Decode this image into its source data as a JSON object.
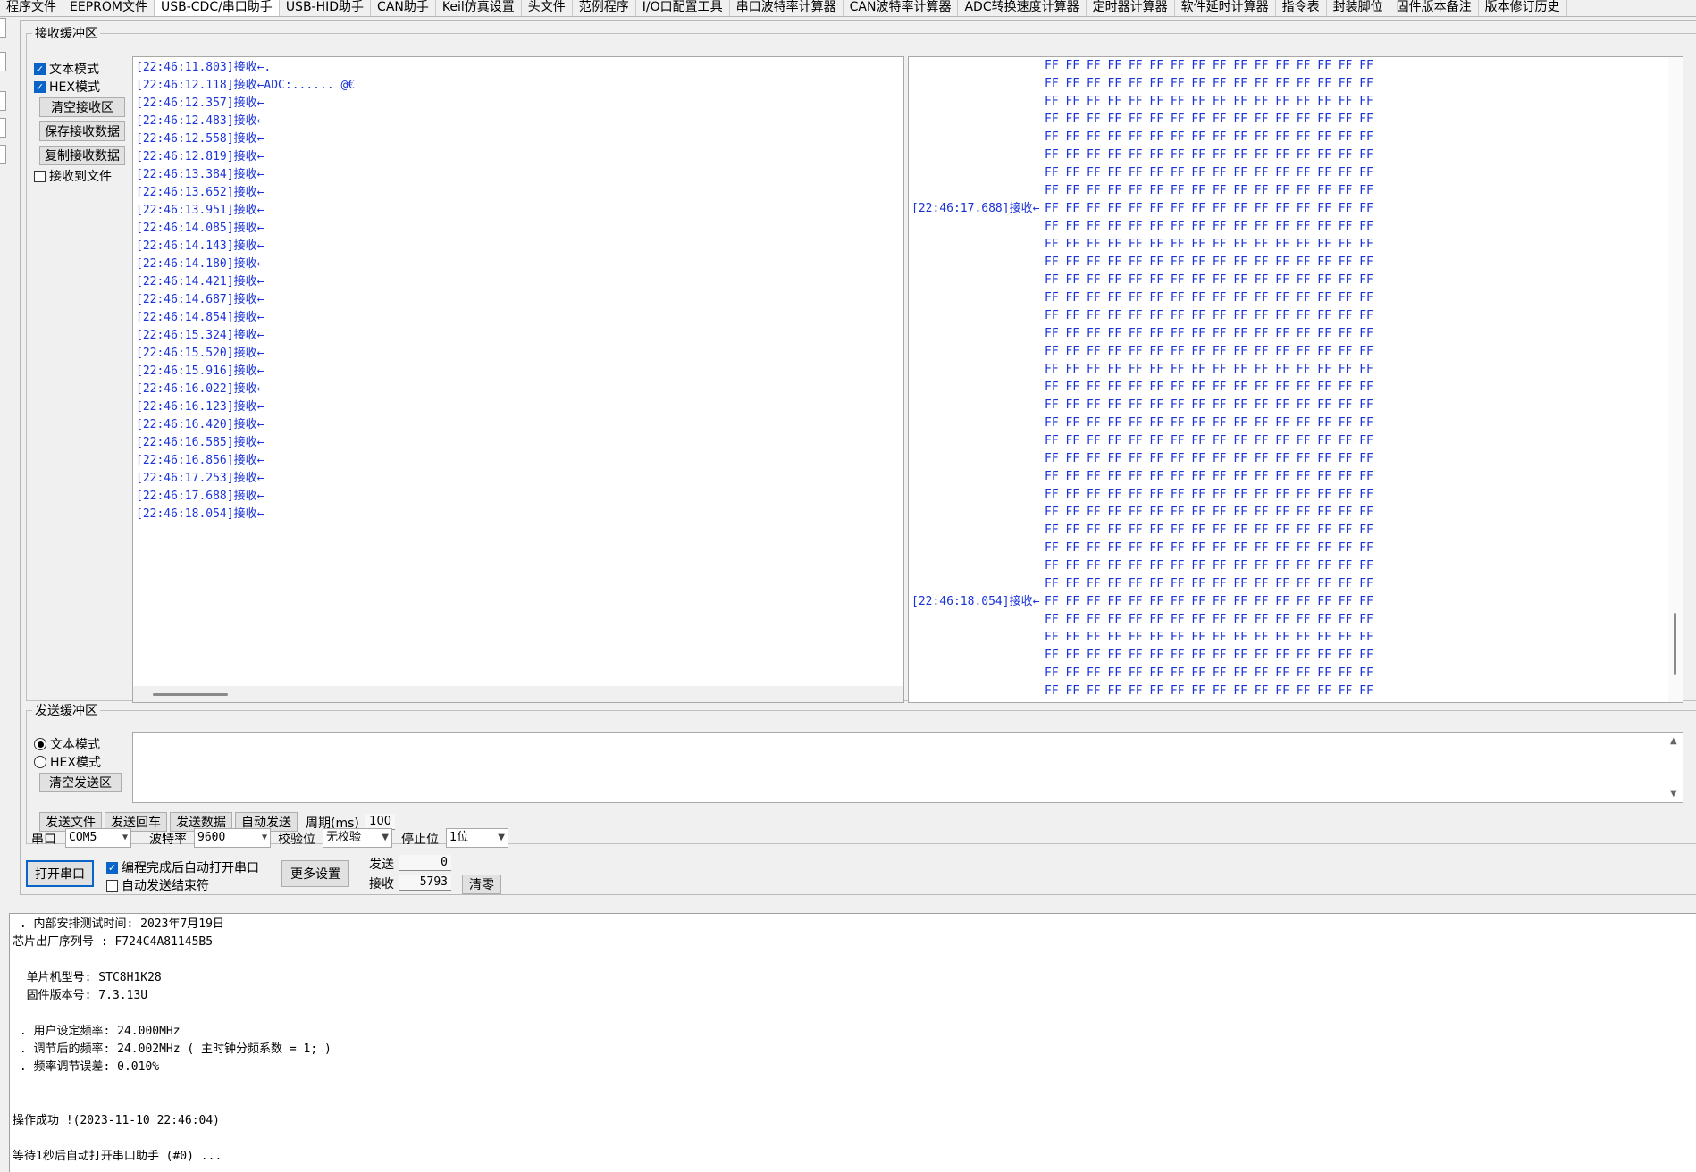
{
  "tabs": [
    "程序文件",
    "EEPROM文件",
    "USB-CDC/串口助手",
    "USB-HID助手",
    "CAN助手",
    "Keil仿真设置",
    "头文件",
    "范例程序",
    "I/O口配置工具",
    "串口波特率计算器",
    "CAN波特率计算器",
    "ADC转换速度计算器",
    "定时器计算器",
    "软件延时计算器",
    "指令表",
    "封装脚位",
    "固件版本备注",
    "版本修订历史"
  ],
  "receive": {
    "legend": "接收缓冲区",
    "text_mode_label": "文本模式",
    "hex_mode_label": "HEX模式",
    "clear_btn": "清空接收区",
    "save_btn": "保存接收数据",
    "copy_btn": "复制接收数据",
    "to_file_label": "接收到文件",
    "text_lines": [
      "[22:46:11.803]接收←.",
      "[22:46:12.118]接收←ADC:...... @€",
      "[22:46:12.357]接收←",
      "[22:46:12.483]接收←",
      "[22:46:12.558]接收←",
      "[22:46:12.819]接收←",
      "[22:46:13.384]接收←",
      "[22:46:13.652]接收←",
      "[22:46:13.951]接收←",
      "[22:46:14.085]接收←",
      "[22:46:14.143]接收←",
      "[22:46:14.180]接收←",
      "[22:46:14.421]接收←",
      "[22:46:14.687]接收←",
      "[22:46:14.854]接收←",
      "[22:46:15.324]接收←",
      "[22:46:15.520]接收←",
      "[22:46:15.916]接收←",
      "[22:46:16.022]接收←",
      "[22:46:16.123]接收←",
      "[22:46:16.420]接收←",
      "[22:46:16.585]接收←",
      "[22:46:16.856]接收←",
      "[22:46:17.253]接收←",
      "[22:46:17.688]接收←",
      "[22:46:18.054]接收←"
    ],
    "hex_row": "FF FF FF FF FF FF FF FF FF FF FF FF FF FF FF FF",
    "hex_prefixes": [
      "",
      "",
      "",
      "",
      "",
      "",
      "",
      "",
      "[22:46:17.688]接收←",
      "",
      "",
      "",
      "",
      "",
      "",
      "",
      "",
      "",
      "",
      "",
      "",
      "",
      "",
      "",
      "",
      "",
      "",
      "",
      "",
      "",
      "[22:46:18.054]接收←",
      "",
      "",
      "",
      "",
      "",
      ""
    ]
  },
  "send": {
    "legend": "发送缓冲区",
    "text_mode_label": "文本模式",
    "hex_mode_label": "HEX模式",
    "clear_btn": "清空发送区",
    "send_file_btn": "发送文件",
    "send_cr_btn": "发送回车",
    "send_data_btn": "发送数据",
    "auto_send_btn": "自动发送",
    "period_label": "周期(ms)",
    "period_value": "100"
  },
  "config": {
    "port_label": "串口",
    "port_value": "COM5",
    "baud_label": "波特率",
    "baud_value": "9600",
    "parity_label": "校验位",
    "parity_value": "无校验",
    "stop_label": "停止位",
    "stop_value": "1位",
    "open_btn": "打开串口",
    "auto_open_label": "编程完成后自动打开串口",
    "auto_end_label": "自动发送结束符",
    "more_btn": "更多设置",
    "sent_label": "发送",
    "sent_value": "0",
    "recv_label": "接收",
    "recv_value": "5793",
    "clear_count_btn": "清零"
  },
  "log_lines": [
    " . 内部安排测试时间: 2023年7月19日",
    "芯片出厂序列号 : F724C4A81145B5",
    "",
    "  单片机型号: STC8H1K28",
    "  固件版本号: 7.3.13U",
    "",
    " . 用户设定频率: 24.000MHz",
    " . 调节后的频率: 24.002MHz ( 主时钟分频系数 = 1; )",
    " . 频率调节误差: 0.010%",
    "",
    "",
    "操作成功 !(2023-11-10 22:46:04)",
    "",
    "等待1秒后自动打开串口助手 (#0) ..."
  ]
}
